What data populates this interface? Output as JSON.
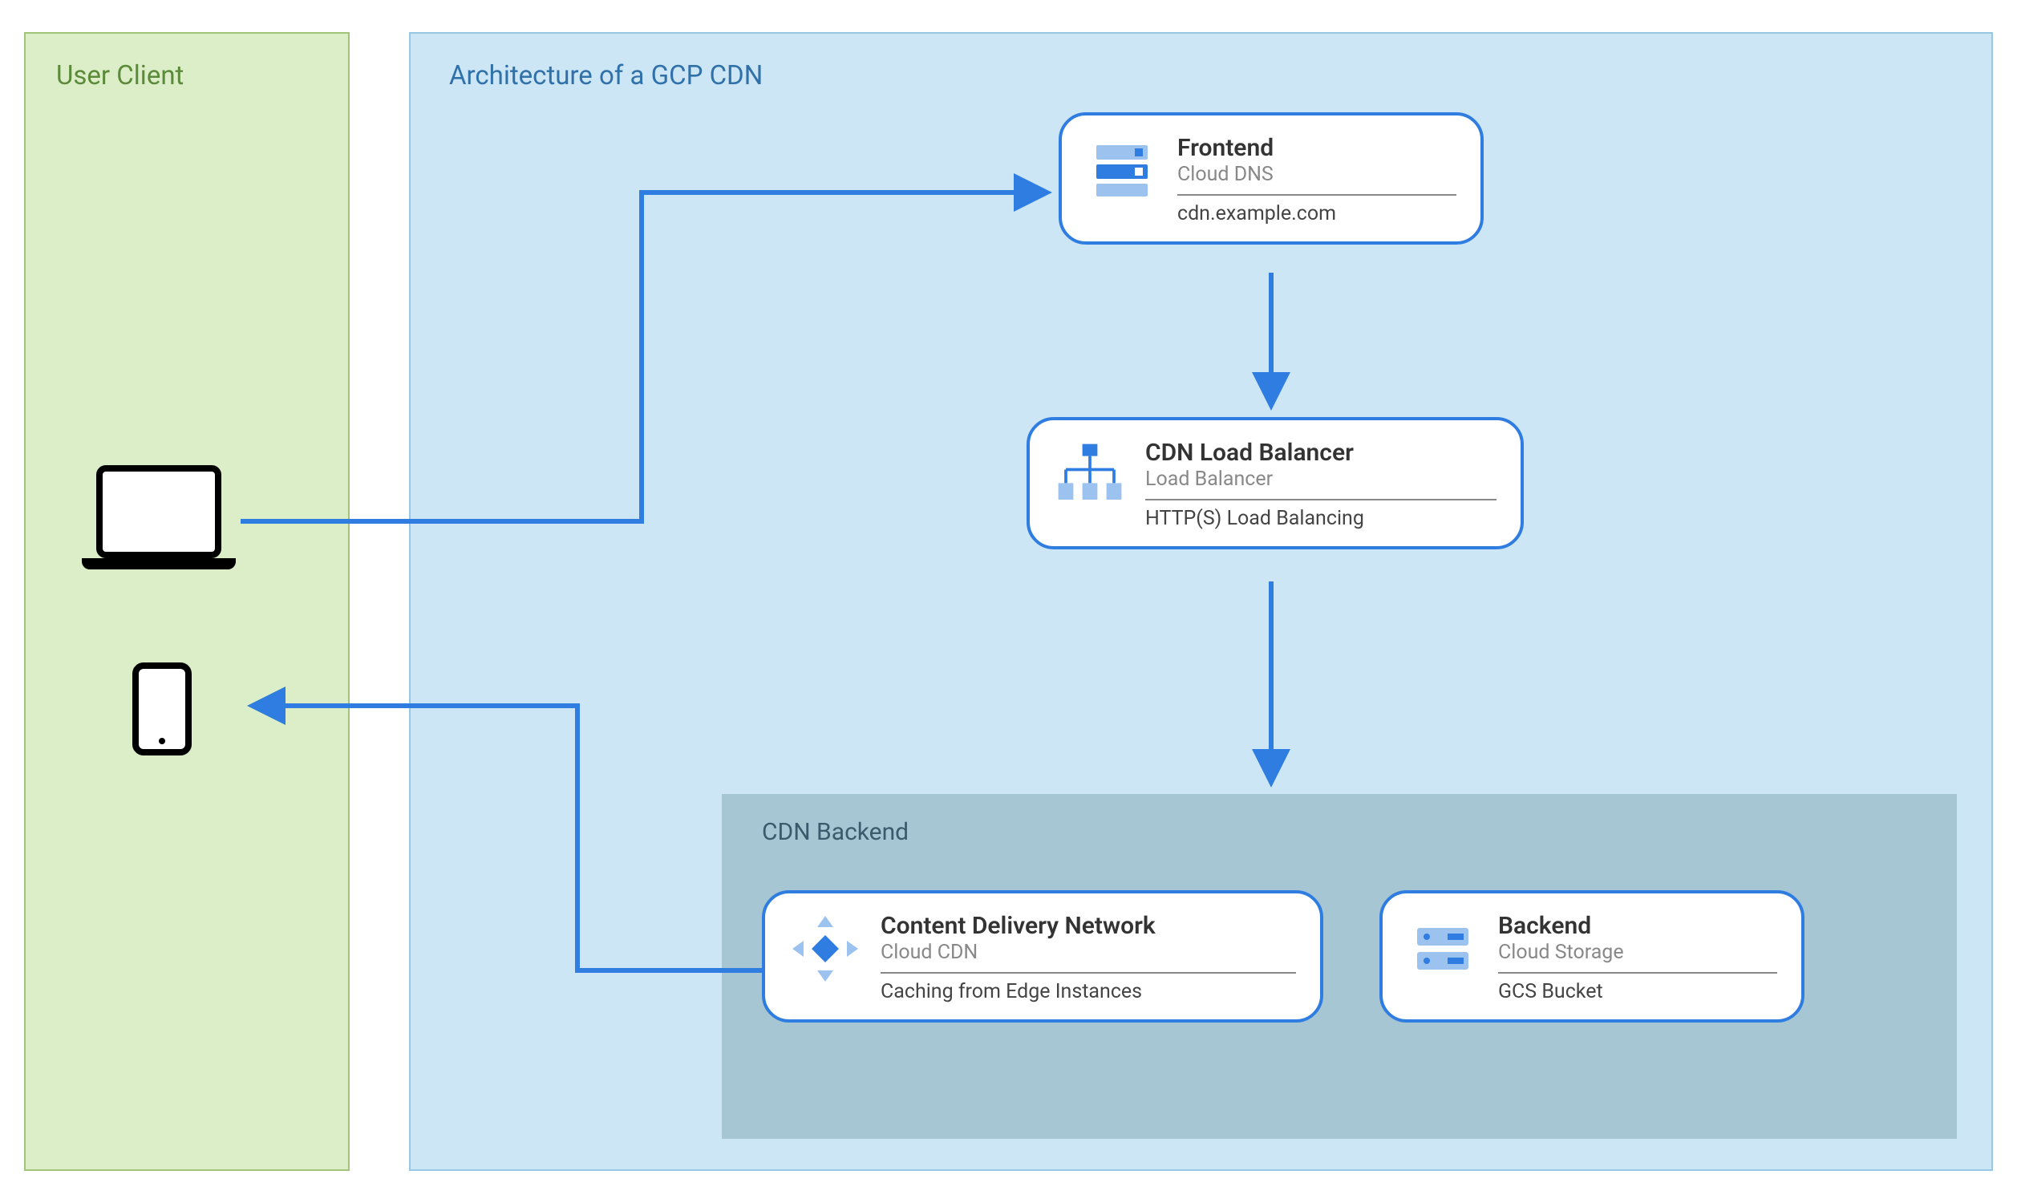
{
  "user_panel": {
    "title": "User Client"
  },
  "arch_panel": {
    "title": "Architecture of a GCP CDN"
  },
  "nodes": {
    "frontend": {
      "heading": "Frontend",
      "sub": "Cloud DNS",
      "detail": "cdn.example.com",
      "icon": "dns-icon"
    },
    "lb": {
      "heading": "CDN Load Balancer",
      "sub": "Load Balancer",
      "detail": "HTTP(S) Load Balancing",
      "icon": "load-balancer-icon"
    },
    "cdn": {
      "heading": "Content Delivery Network",
      "sub": "Cloud CDN",
      "detail": "Caching from Edge Instances",
      "icon": "cdn-icon"
    },
    "storage": {
      "heading": "Backend",
      "sub": "Cloud Storage",
      "detail": "GCS Bucket",
      "icon": "storage-icon"
    }
  },
  "backend_group": {
    "title": "CDN Backend"
  },
  "arrows": [
    {
      "name": "client-to-frontend",
      "from": "user-client",
      "to": "frontend"
    },
    {
      "name": "frontend-to-lb",
      "from": "frontend",
      "to": "lb"
    },
    {
      "name": "lb-to-backend-group",
      "from": "lb",
      "to": "backend-group"
    },
    {
      "name": "cdn-to-client",
      "from": "cdn",
      "to": "user-client"
    }
  ],
  "colors": {
    "arrow": "#2f7de1",
    "user_bg": "#dceec7",
    "arch_bg": "#cce6f5",
    "backend_bg": "#a6c6d4"
  }
}
